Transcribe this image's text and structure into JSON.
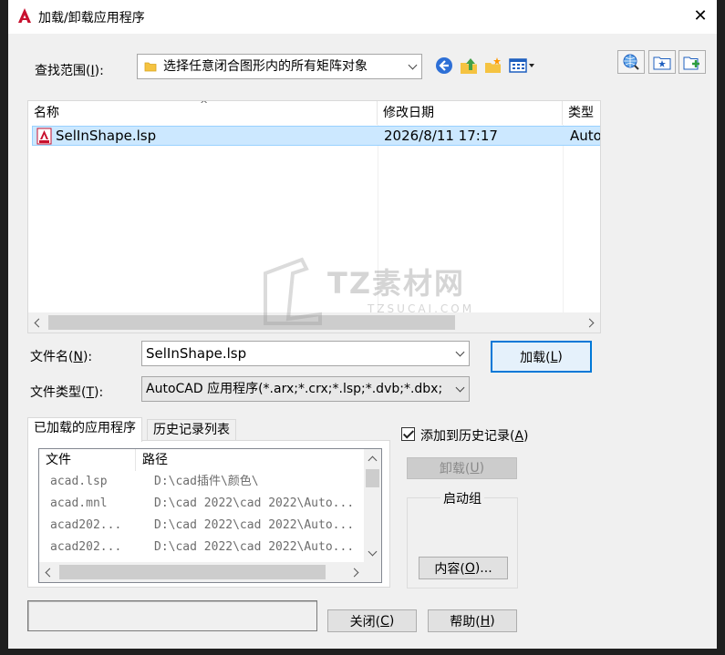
{
  "window": {
    "title": "加载/卸载应用程序",
    "close_glyph": "✕"
  },
  "lookin": {
    "label": "查找范围(I):",
    "label_prefix": "查找范围(",
    "label_key": "I",
    "label_suffix": "):",
    "value": "选择任意闭合图形内的所有矩阵对象"
  },
  "filelist": {
    "columns": [
      "名称",
      "修改日期",
      "类型"
    ],
    "rows": [
      {
        "name": "SelInShape.lsp",
        "date": "2026/8/11 17:17",
        "type": "Auto"
      }
    ]
  },
  "filename": {
    "label_prefix": "文件名(",
    "label_key": "N",
    "label_suffix": "):",
    "value": "SelInShape.lsp"
  },
  "filetype": {
    "label_prefix": "文件类型(",
    "label_key": "T",
    "label_suffix": "):",
    "value": "AutoCAD 应用程序(*.arx;*.crx;*.lsp;*.dvb;*.dbx;"
  },
  "load_button": {
    "prefix": "加载(",
    "key": "L",
    "suffix": ")"
  },
  "tabs": [
    "已加载的应用程序",
    "历史记录列表"
  ],
  "loaded": {
    "columns": [
      "文件",
      "路径"
    ],
    "rows": [
      {
        "file": "acad.lsp",
        "path": "D:\\cad插件\\颜色\\"
      },
      {
        "file": "acad.mnl",
        "path": "D:\\cad 2022\\cad 2022\\Auto..."
      },
      {
        "file": "acad202...",
        "path": "D:\\cad 2022\\cad 2022\\Auto..."
      },
      {
        "file": "acad202...",
        "path": "D:\\cad 2022\\cad 2022\\Auto..."
      }
    ]
  },
  "history_checkbox": {
    "prefix": "添加到历史记录(",
    "key": "A",
    "suffix": ")",
    "checked": true
  },
  "unload_button": {
    "prefix": "卸载(",
    "key": "U",
    "suffix": ")"
  },
  "startup_group": {
    "title": "启动组",
    "contents_prefix": "内容(",
    "contents_key": "O",
    "contents_suffix": ")..."
  },
  "close_button": {
    "prefix": "关闭(",
    "key": "C",
    "suffix": ")"
  },
  "help_button": {
    "prefix": "帮助(",
    "key": "H",
    "suffix": ")"
  },
  "watermark": {
    "brand": "TZ素材网",
    "url": "TZSUCAI.COM"
  },
  "colors": {
    "selection": "#cce8ff",
    "accent": "#0078d7",
    "app_red": "#c8102e"
  },
  "icons": [
    "autocad-app-icon",
    "folder-icon",
    "back-icon",
    "up-folder-icon",
    "new-folder-icon",
    "views-menu-icon",
    "web-search-icon",
    "add-favorites-icon",
    "add-to-startup-icon",
    "lsp-file-icon"
  ]
}
